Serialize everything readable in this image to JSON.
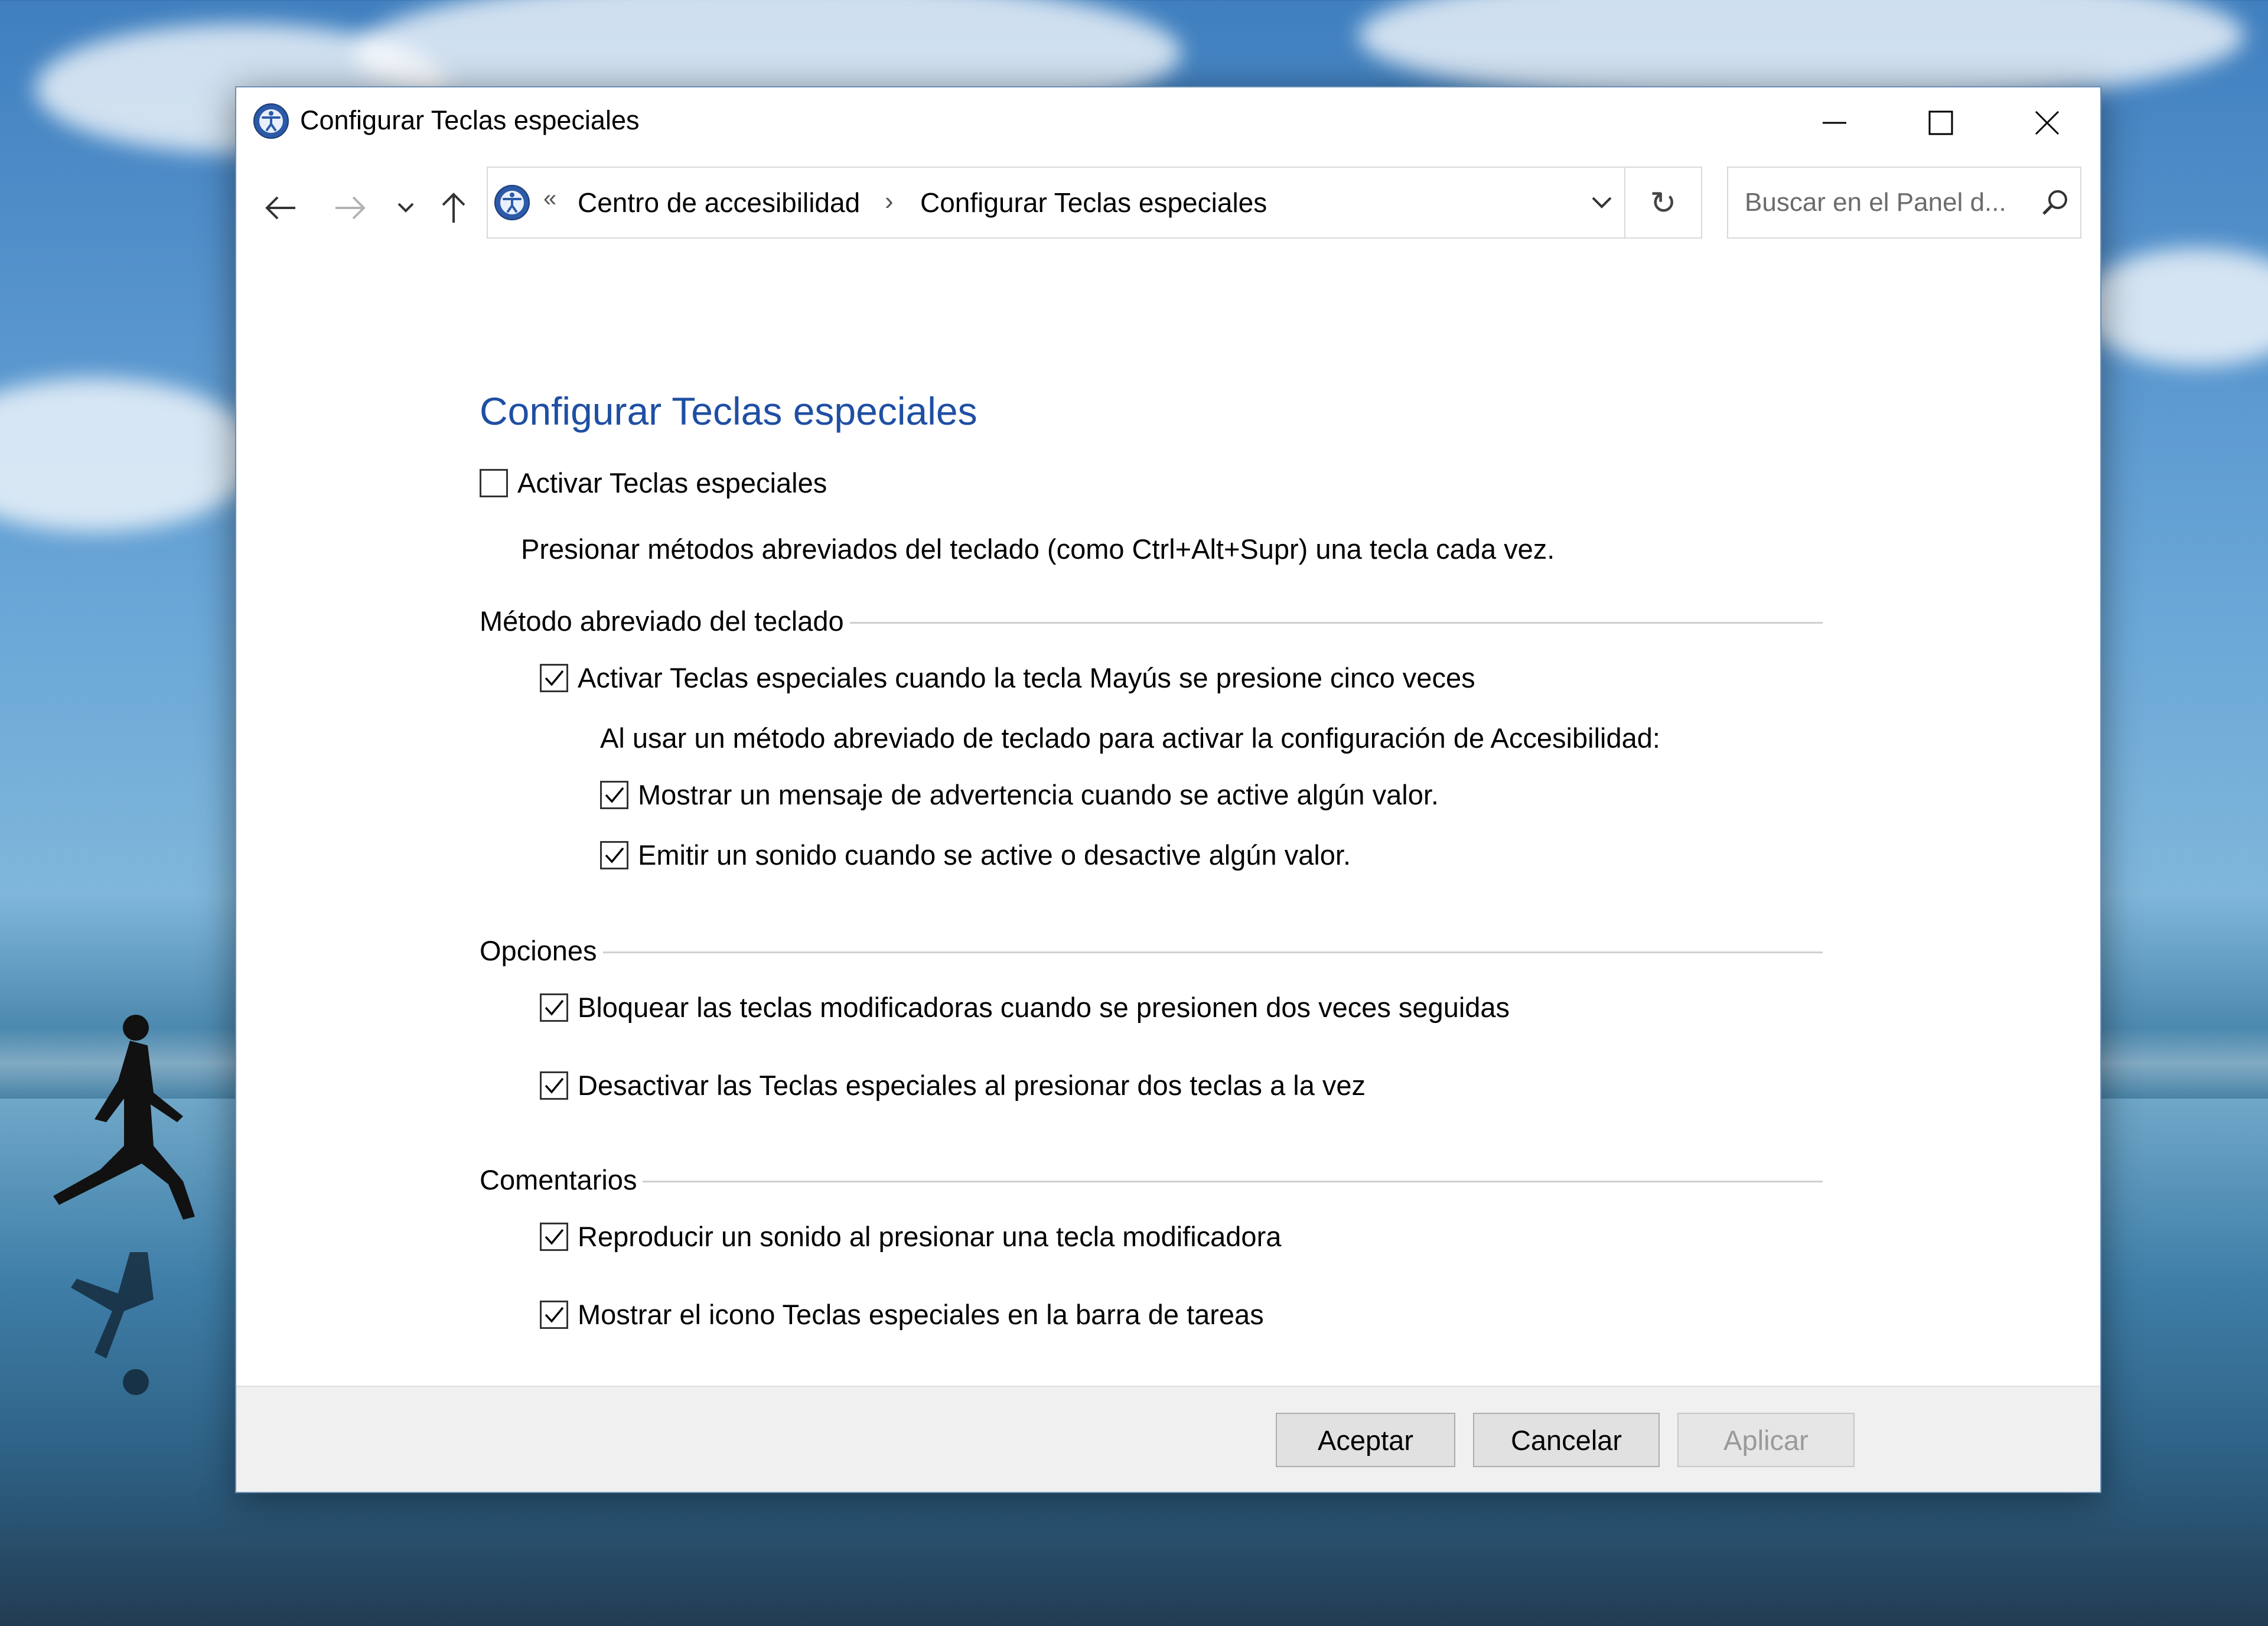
{
  "window": {
    "title": "Configurar Teclas especiales"
  },
  "nav": {
    "back_icon": "arrow-left-icon",
    "forward_icon": "arrow-right-icon",
    "recent_icon": "chevron-down-icon",
    "up_icon": "arrow-up-icon",
    "breadcrumb_overflow": "«",
    "breadcrumb": [
      "Centro de accesibilidad",
      "Configurar Teclas especiales"
    ],
    "breadcrumb_separator": "›",
    "refresh_icon": "↻",
    "search_placeholder": "Buscar en el Panel d..."
  },
  "main": {
    "title": "Configurar Teclas especiales",
    "activate": {
      "label": "Activar Teclas especiales",
      "checked": false
    },
    "activate_desc": "Presionar métodos abreviados del teclado (como Ctrl+Alt+Supr) una tecla cada vez.",
    "shortcut_group": {
      "heading": "Método abreviado del teclado",
      "activate_shift": {
        "label": "Activar Teclas especiales cuando la tecla Mayús se presione cinco veces",
        "checked": true
      },
      "subtext": "Al usar un método abreviado de teclado para activar la configuración de Accesibilidad:",
      "warning_msg": {
        "label": "Mostrar un mensaje de advertencia cuando se active algún valor.",
        "checked": true
      },
      "sound": {
        "label": "Emitir un sonido cuando se active o desactive algún valor.",
        "checked": true
      }
    },
    "options_group": {
      "heading": "Opciones",
      "lock_modifiers": {
        "label": "Bloquear las teclas modificadoras cuando se presionen dos veces seguidas",
        "checked": true
      },
      "disable_two_keys": {
        "label": "Desactivar las Teclas especiales al presionar dos teclas a la vez",
        "checked": true
      }
    },
    "feedback_group": {
      "heading": "Comentarios",
      "play_sound": {
        "label": "Reproducir un sonido al presionar una tecla modificadora",
        "checked": true
      },
      "show_icon": {
        "label": "Mostrar el icono Teclas especiales en la barra de tareas",
        "checked": true
      }
    }
  },
  "footer": {
    "ok": "Aceptar",
    "cancel": "Cancelar",
    "apply": "Aplicar"
  },
  "colors": {
    "title_blue": "#1f4fa3"
  }
}
